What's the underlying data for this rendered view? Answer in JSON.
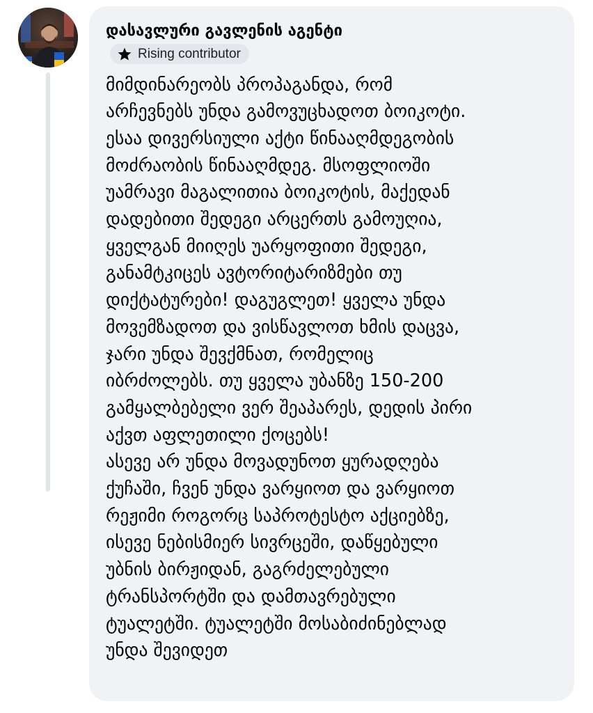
{
  "author": {
    "name": "დასავლური გავლენის აგენტი",
    "badge_label": "Rising contributor",
    "badge_icon": "star-icon"
  },
  "avatar": {
    "icon": "avatar",
    "flag_colors": [
      "#1f5ec4",
      "#f2c318"
    ]
  },
  "colors": {
    "bubble_bg": "#f0f2f5",
    "badge_bg": "#e4e6eb",
    "thread_line": "#e3e5e8",
    "text": "#050505"
  },
  "comment": {
    "lines": [
      "მიმდინარეობს პროპაგანდა, რომ",
      "არჩევნებს უნდა გამოვუცხადოთ ბოიკოტი.",
      "ესაა დივერსიული აქტი წინააღმდეგობის",
      "მოძრაობის წინააღმდეგ. მსოფლიოში",
      "უამრავი მაგალითია ბოიკოტის, მაქედან",
      "დადებითი შედეგი არცერთს გამოუღია,",
      "ყველგან მიიღეს უარყოფითი შედეგი,",
      "განამტკიცეს ავტორიტარიზმები თუ",
      "დიქტატურები! დაგუგლეთ! ყველა უნდა",
      "მოვემზადოთ და ვისწავლოთ ხმის დაცვა,",
      "ჯარი უნდა შევქმნათ, რომელიც",
      "იბრძოლებს. თუ ყველა უბანზე 150-200",
      "გამყალბებელი ვერ შეაპარეს, დედის პირი",
      "აქვთ აფლეთილი ქოცებს!",
      "ასევე არ უნდა მოვადუნოთ ყურადღება",
      "ქუჩაში, ჩვენ უნდა ვარყიოთ და ვარყიოთ",
      "რეჟიმი როგორც საპროტესტო აქციებზე,",
      "ისევე ნებისმიერ სივრცეში, დაწყებული",
      "უბნის ბირჟიდან, გაგრძელებული",
      "ტრანსპორტში და დამთავრებული",
      "ტუალეტში. ტუალეტში მოსაბიძინებლად",
      "უნდა შევიდეთ"
    ]
  }
}
